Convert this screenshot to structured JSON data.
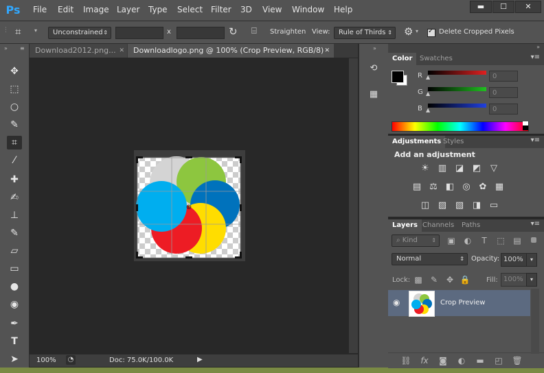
{
  "app": {
    "logo": "Ps"
  },
  "menu": [
    "File",
    "Edit",
    "Image",
    "Layer",
    "Type",
    "Select",
    "Filter",
    "3D",
    "View",
    "Window",
    "Help"
  ],
  "window_controls": {
    "minimize": "▬",
    "maximize": "☐",
    "close": "✕"
  },
  "options": {
    "ratio": "Unconstrained",
    "times": "x",
    "straighten": "Straighten",
    "view_label": "View:",
    "view_value": "Rule of Thirds",
    "delete_cropped": "Delete Cropped Pixels",
    "delete_cropped_checked": true
  },
  "tabs": [
    {
      "label": "Download2012.png...",
      "close": "✕",
      "active": false
    },
    {
      "label": "Downloadlogo.png @ 100% (Crop Preview, RGB/8)",
      "close": "✕",
      "active": true
    }
  ],
  "status": {
    "zoom": "100%",
    "doc": "Doc: 75.0K/100.0K"
  },
  "color_panel": {
    "tabs": [
      "Color",
      "Swatches"
    ],
    "channels": [
      {
        "label": "R",
        "value": "0",
        "color": "#e02020"
      },
      {
        "label": "G",
        "value": "0",
        "color": "#20c020"
      },
      {
        "label": "B",
        "value": "0",
        "color": "#2040e0"
      }
    ],
    "foreground": "#000000",
    "background": "#ffffff"
  },
  "adjustments_panel": {
    "tabs": [
      "Adjustments",
      "Styles"
    ],
    "heading": "Add an adjustment"
  },
  "layers_panel": {
    "tabs": [
      "Layers",
      "Channels",
      "Paths"
    ],
    "filter": "Kind",
    "blend_mode": "Normal",
    "opacity_label": "Opacity:",
    "opacity": "100%",
    "lock_label": "Lock:",
    "fill_label": "Fill:",
    "fill": "100%",
    "layer_name": "Crop Preview"
  },
  "logo_colors": [
    "#d4d4d4",
    "#8dc63f",
    "#0072bc",
    "#ffdd00",
    "#ed1c24",
    "#00aeef"
  ]
}
